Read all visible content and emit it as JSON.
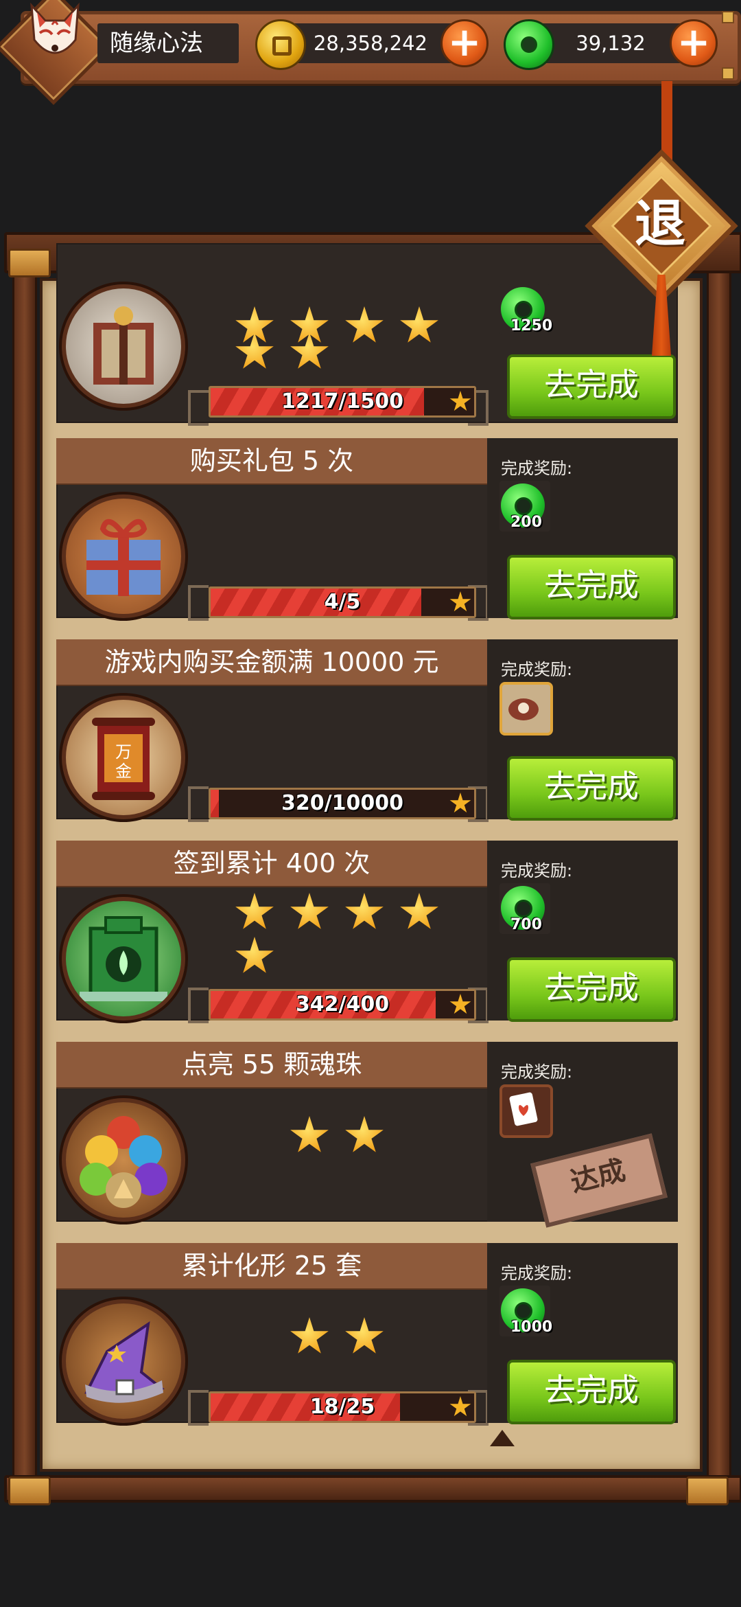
{
  "header": {
    "player_name": "随缘心法",
    "gold_amount": "28,358,242",
    "jade_amount": "39,132",
    "add_symbol": "+"
  },
  "exit_label": "退",
  "reward_label": "完成奖励:",
  "go_label": "去完成",
  "achieved_label": "达成",
  "tasks": [
    {
      "title": "",
      "stars": 6,
      "progress_text": "1217/1500",
      "progress": 0.811,
      "reward_type": "jade",
      "reward_count": "1250",
      "status": "go"
    },
    {
      "title": "购买礼包 5 次",
      "stars": 0,
      "progress_text": "4/5",
      "progress": 0.8,
      "reward_type": "jade",
      "reward_count": "200",
      "status": "go"
    },
    {
      "title": "游戏内购买金额满 10000 元",
      "stars": 0,
      "progress_text": "320/10000",
      "progress": 0.032,
      "reward_type": "item",
      "reward_count": "",
      "status": "go"
    },
    {
      "title": "签到累计 400 次",
      "stars": 5,
      "progress_text": "342/400",
      "progress": 0.855,
      "reward_type": "jade",
      "reward_count": "700",
      "status": "go"
    },
    {
      "title": "点亮 55 颗魂珠",
      "stars": 2,
      "progress_text": "",
      "progress": 0,
      "reward_type": "card",
      "reward_count": "",
      "status": "achieved"
    },
    {
      "title": "累计化形 25 套",
      "stars": 2,
      "progress_text": "18/25",
      "progress": 0.72,
      "reward_type": "jade",
      "reward_count": "1000",
      "status": "go"
    }
  ],
  "colors": {
    "go_button": "#79c71b",
    "progress_fill": "#e64036",
    "card_bg": "#2f2824",
    "title_bar": "#8e5a3b",
    "parchment": "#d3b98e"
  },
  "icons": [
    "fox-mask-avatar-icon",
    "gold-coin-icon",
    "jade-icon",
    "plus-icon",
    "armor-icon",
    "gift-box-icon",
    "scroll-icon",
    "green-shrine-icon",
    "spirit-orbs-icon",
    "wizard-hat-icon",
    "star-icon",
    "card-item-icon",
    "pouch-item-icon"
  ]
}
